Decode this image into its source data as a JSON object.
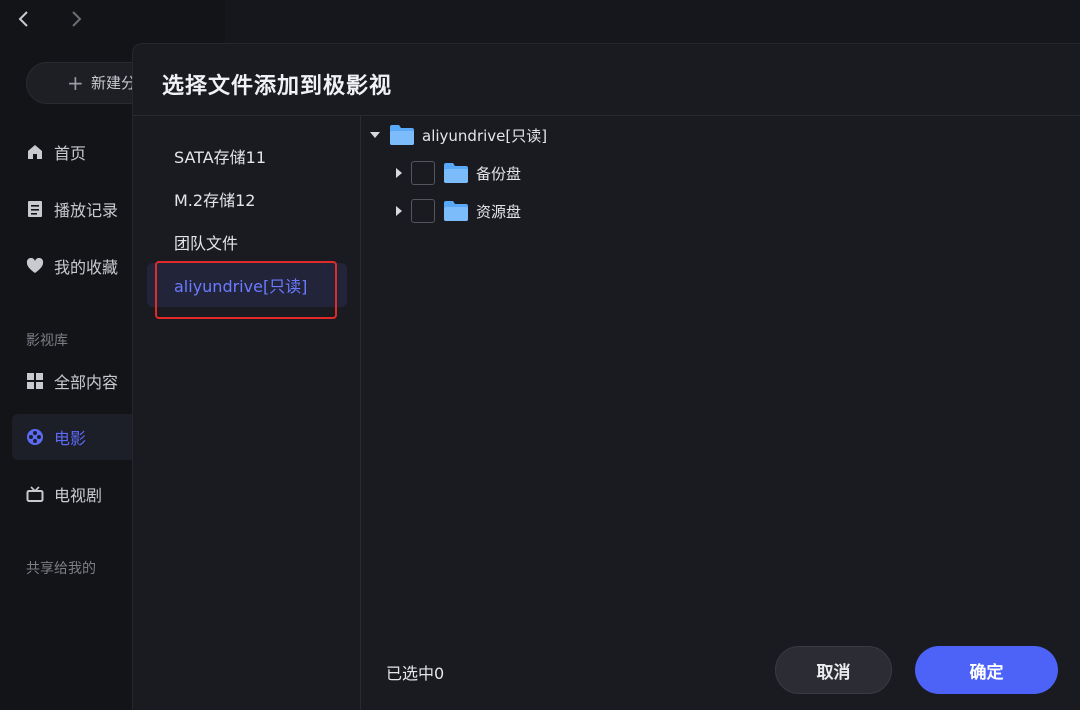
{
  "sidebar": {
    "new_folder_label": "新建分",
    "items": [
      {
        "label": "首页",
        "icon": "home-icon"
      },
      {
        "label": "播放记录",
        "icon": "history-icon"
      },
      {
        "label": "我的收藏",
        "icon": "heart-icon"
      }
    ],
    "library_heading": "影视库",
    "library_items": [
      {
        "label": "全部内容",
        "icon": "grid-icon"
      },
      {
        "label": "电影",
        "icon": "film-reel-icon",
        "active": true
      },
      {
        "label": "电视剧",
        "icon": "tv-icon"
      }
    ],
    "shared_heading": "共享给我的"
  },
  "dialog": {
    "title": "选择文件添加到极影视",
    "sources": [
      {
        "label": "SATA存储11"
      },
      {
        "label": "M.2存储12"
      },
      {
        "label": "团队文件"
      },
      {
        "label": "aliyundrive[只读]",
        "active": true
      }
    ],
    "tree": {
      "root_label": "aliyundrive[只读]",
      "children": [
        {
          "label": "备份盘",
          "checked": false
        },
        {
          "label": "资源盘",
          "checked": false
        }
      ]
    },
    "selected_count_text": "已选中0",
    "cancel_label": "取消",
    "confirm_label": "确定"
  },
  "colors": {
    "accent": "#4d63f7",
    "folder": "#5aa9f8",
    "highlight_box": "#e02b2b"
  }
}
